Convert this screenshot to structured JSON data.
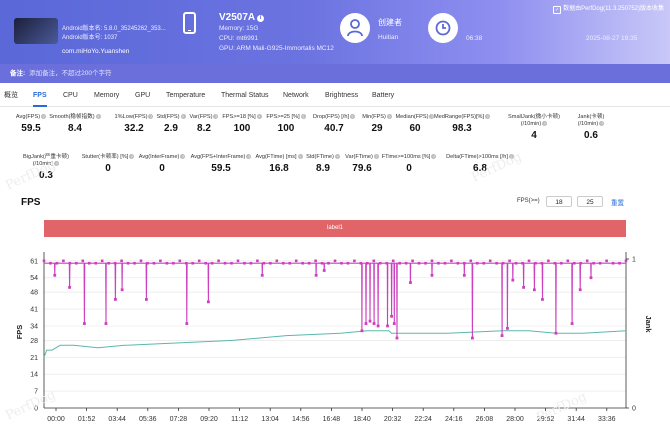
{
  "header": {
    "app_version": "Android版本名: 5.8.0_35245262_353...",
    "app_version_code": "Android版本号: 1037",
    "package": "com.miHoYo.Yuanshen",
    "device_name": "V2507A",
    "memory": "Memory: 15G",
    "cpu": "CPU: mt6991",
    "gpu": "GPU: ARM Mali-G925-Immortalis MC12",
    "creator_label": "创建者",
    "creator_name": "Huitian",
    "time_start": "06:38",
    "time_end": "2025-08-27 19:35",
    "source": "数据由PerfDog(11.3.250752)版本收集"
  },
  "note": {
    "label": "备注:",
    "placeholder": "添加备注，不超过200个字符"
  },
  "tabs": [
    "概览",
    "FPS",
    "CPU",
    "Memory",
    "GPU",
    "Temperature",
    "Thermal Status",
    "Network",
    "Brightness",
    "Battery"
  ],
  "active_tab": "FPS",
  "stats_row1": [
    {
      "label": "Avg(FPS)",
      "value": "59.5"
    },
    {
      "label": "Smooth(稳帧指数)",
      "value": "8.4"
    },
    {
      "label": "1%Low(FPS)",
      "value": "32.2"
    },
    {
      "label": "Std(FPS)",
      "value": "2.9"
    },
    {
      "label": "Var(FPS)",
      "value": "8.2"
    },
    {
      "label": "FPS>=18 [%]",
      "value": "100"
    },
    {
      "label": "FPS>=25 [%]",
      "value": "100"
    },
    {
      "label": "Drop(FPS) [/h]",
      "value": "40.7"
    },
    {
      "label": "Min(FPS)",
      "value": "29"
    },
    {
      "label": "Median(FPS)",
      "value": "60"
    },
    {
      "label": "MedRange(FPS)[%]",
      "value": "98.3"
    },
    {
      "label": "SmallJank(微小卡顿)",
      "label2": "(/10min)",
      "value": "4"
    },
    {
      "label": "Jank(卡顿)",
      "label2": "(/10min)",
      "value": "0.6"
    }
  ],
  "stats_row2": [
    {
      "label": "BigJank(严重卡顿)",
      "label2": "(/10min)",
      "value": "0.3"
    },
    {
      "label": "Stutter(卡顿率) [%]",
      "value": "0"
    },
    {
      "label": "Avg(InterFrame)",
      "value": "0"
    },
    {
      "label": "Avg(FPS+InterFrame)",
      "value": "59.5"
    },
    {
      "label": "Avg(FTime) [ms]",
      "value": "16.8"
    },
    {
      "label": "Std(FTime)",
      "value": "8.9"
    },
    {
      "label": "Var(FTime)",
      "value": "79.6"
    },
    {
      "label": "FTime>=100ms [%]",
      "value": "0"
    },
    {
      "label": "Delta(FTime)>100ms [/h]",
      "value": "6.8"
    }
  ],
  "fps_panel": {
    "title": "FPS",
    "threshold_label": "FPS(>=)",
    "threshold_low": "18",
    "threshold_high": "25",
    "reset_label": "重置",
    "label_band": "label1"
  },
  "chart_data": {
    "type": "line",
    "xlabel": "",
    "ylabel": "FPS",
    "y2label": "Jank",
    "ylim": [
      0,
      63
    ],
    "y_ticks": [
      0,
      7,
      14,
      21,
      28,
      34,
      41,
      48,
      54,
      61
    ],
    "y2_ticks": [
      "0",
      "1"
    ],
    "x_ticks": [
      "00:00",
      "01:52",
      "03:44",
      "05:36",
      "07:28",
      "09:20",
      "11:12",
      "13:04",
      "14:56",
      "16:48",
      "18:40",
      "20:32",
      "22:24",
      "24:16",
      "26:08",
      "28:00",
      "29:52",
      "31:44",
      "33:36"
    ],
    "duration_s": 2160,
    "fps_series": {
      "color": "#cc3fbf",
      "baseline": 60,
      "dips": [
        [
          40,
          55
        ],
        [
          95,
          50
        ],
        [
          150,
          35
        ],
        [
          230,
          35
        ],
        [
          265,
          45
        ],
        [
          290,
          49
        ],
        [
          380,
          45
        ],
        [
          530,
          35
        ],
        [
          610,
          44
        ],
        [
          810,
          55
        ],
        [
          1010,
          55
        ],
        [
          1040,
          57
        ],
        [
          1180,
          32
        ],
        [
          1195,
          35
        ],
        [
          1210,
          36
        ],
        [
          1225,
          35
        ],
        [
          1240,
          34
        ],
        [
          1275,
          34
        ],
        [
          1290,
          38
        ],
        [
          1300,
          35
        ],
        [
          1310,
          29
        ],
        [
          1360,
          52
        ],
        [
          1440,
          55
        ],
        [
          1560,
          55
        ],
        [
          1590,
          29
        ],
        [
          1700,
          30
        ],
        [
          1720,
          33
        ],
        [
          1740,
          53
        ],
        [
          1780,
          50
        ],
        [
          1820,
          49
        ],
        [
          1850,
          45
        ],
        [
          1900,
          31
        ],
        [
          1960,
          35
        ],
        [
          1990,
          49
        ],
        [
          2030,
          54
        ]
      ]
    },
    "line2_series": {
      "color": "#5ab7ad",
      "points": [
        [
          0,
          21
        ],
        [
          10,
          24
        ],
        [
          30,
          24
        ],
        [
          60,
          26
        ],
        [
          110,
          26
        ],
        [
          200,
          25
        ],
        [
          300,
          26
        ],
        [
          500,
          27
        ],
        [
          700,
          28
        ],
        [
          900,
          30
        ],
        [
          1100,
          31
        ],
        [
          1200,
          32
        ],
        [
          1280,
          32
        ],
        [
          1290,
          31
        ],
        [
          1340,
          31
        ],
        [
          1500,
          31
        ],
        [
          1700,
          32
        ],
        [
          1800,
          32
        ],
        [
          1900,
          31
        ],
        [
          2000,
          31
        ],
        [
          2160,
          32
        ]
      ]
    }
  }
}
